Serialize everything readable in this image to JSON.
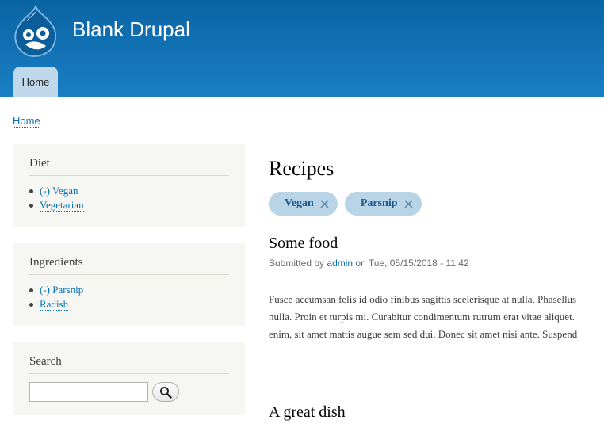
{
  "header": {
    "site_name": "Blank Drupal",
    "tabs": [
      {
        "label": "Home"
      }
    ],
    "brand_color": "#0a64a3"
  },
  "breadcrumb": {
    "items": [
      "Home"
    ]
  },
  "sidebar": {
    "diet": {
      "title": "Diet",
      "items": [
        {
          "label": "(-) Vegan",
          "active": true
        },
        {
          "label": "Vegetarian",
          "active": false
        }
      ]
    },
    "ingredients": {
      "title": "Ingredients",
      "items": [
        {
          "label": "(-) Parsnip",
          "active": true
        },
        {
          "label": "Radish",
          "active": false
        }
      ]
    },
    "search": {
      "title": "Search",
      "value": "",
      "button_icon": "magnifier-icon"
    }
  },
  "main": {
    "title": "Recipes",
    "active_filters": [
      {
        "label": "Vegan",
        "remove_icon": "close-icon"
      },
      {
        "label": "Parsnip",
        "remove_icon": "close-icon"
      }
    ],
    "nodes": [
      {
        "title": "Some food",
        "submitted_prefix": "Submitted by",
        "author": "admin",
        "submitted_suffix": "on Tue, 05/15/2018 - 11:42",
        "body_lines": [
          "Fusce accumsan felis id odio finibus sagittis scelerisque at nulla. Phasellus",
          "nulla. Proin et turpis mi. Curabitur condimentum rutrum erat vitae aliquet.",
          "enim, sit amet mattis augue sem sed dui. Donec sit amet nisi ante. Suspend"
        ]
      },
      {
        "title": "A great dish"
      }
    ]
  }
}
